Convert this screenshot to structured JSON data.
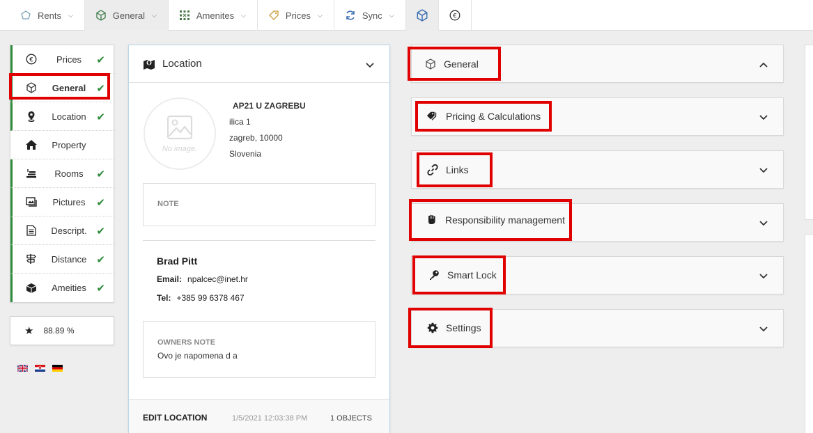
{
  "topnav": [
    {
      "label": "Rents",
      "icon": "rents-icon",
      "has_chevron": true
    },
    {
      "label": "General",
      "icon": "cube-icon",
      "has_chevron": true
    },
    {
      "label": "Amenites",
      "icon": "amenities-grid-icon",
      "has_chevron": true
    },
    {
      "label": "Prices",
      "icon": "price-tag-icon",
      "has_chevron": true
    },
    {
      "label": "Sync",
      "icon": "sync-icon",
      "has_chevron": true
    }
  ],
  "sidebar": {
    "items": [
      {
        "label": "Prices",
        "icon": "euro-icon",
        "checked": true
      },
      {
        "label": "General",
        "icon": "cube-icon",
        "checked": true
      },
      {
        "label": "Location",
        "icon": "location-pin-icon",
        "checked": true
      },
      {
        "label": "Property",
        "icon": "home-icon",
        "checked": false
      },
      {
        "label": "Rooms",
        "icon": "rooms-icon",
        "checked": true
      },
      {
        "label": "Pictures",
        "icon": "pictures-icon",
        "checked": true
      },
      {
        "label": "Descript.",
        "icon": "document-icon",
        "checked": true
      },
      {
        "label": "Distance",
        "icon": "signpost-icon",
        "checked": true
      },
      {
        "label": "Ameities",
        "icon": "box-icon",
        "checked": true
      }
    ],
    "score": "88.89 %"
  },
  "location": {
    "title": "Location",
    "no_image": "No image.",
    "property_name": "AP21 U ZAGREBU",
    "street": "ilica 1",
    "city": "zagreb, 10000",
    "country": "Slovenia",
    "note_label": "NOTE",
    "contact_name": "Brad Pitt",
    "email_label": "Email:",
    "email": "npalcec@inet.hr",
    "tel_label": "Tel:",
    "tel": "+385 99 6378 467",
    "owners_note_label": "OWNERS NOTE",
    "owners_note": "Ovo je napomena d a",
    "edit_label": "EDIT LOCATION",
    "timestamp": "1/5/2021 12:03:38 PM",
    "objects": "1 OBJECTS"
  },
  "accordion": [
    {
      "label": "General",
      "icon": "cube-icon",
      "expanded": true
    },
    {
      "label": "Pricing & Calculations",
      "icon": "tags-icon",
      "expanded": false
    },
    {
      "label": "Links",
      "icon": "link-icon",
      "expanded": false
    },
    {
      "label": "Responsibility management",
      "icon": "fist-icon",
      "expanded": false
    },
    {
      "label": "Smart Lock",
      "icon": "key-icon",
      "expanded": false
    },
    {
      "label": "Settings",
      "icon": "gear-icon",
      "expanded": false
    }
  ],
  "colors": {
    "check_green": "#2e8b3b",
    "highlight_red": "#e00000",
    "accent_border": "#b9d6ea"
  }
}
